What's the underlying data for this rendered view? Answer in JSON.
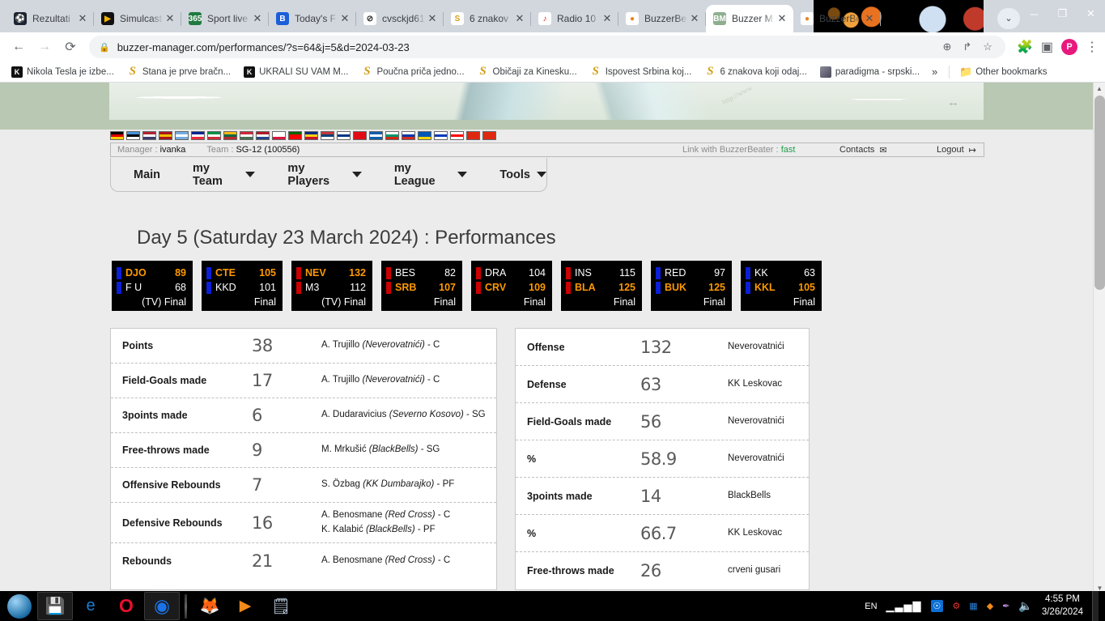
{
  "browser": {
    "tabs": [
      {
        "label": "Rezultati",
        "favicon": "soccer-ball-icon",
        "fav_bg": "#1b2430",
        "fav_fg": "#ffffff",
        "fav_text": "⚽",
        "active": false
      },
      {
        "label": "Simulcast",
        "favicon": "play-circle-icon",
        "fav_bg": "#111111",
        "fav_fg": "#f5b301",
        "fav_text": "▶",
        "active": false
      },
      {
        "label": "Sport live",
        "favicon": "365-icon",
        "fav_bg": "#1f7a3f",
        "fav_fg": "#ffffff",
        "fav_text": "365",
        "active": false
      },
      {
        "label": "Today's F",
        "favicon": "b-logo-icon",
        "fav_bg": "#1a5ed8",
        "fav_fg": "#ffffff",
        "fav_text": "B",
        "active": false
      },
      {
        "label": "cvsckjd61",
        "favicon": "circle-slash-icon",
        "fav_bg": "#ffffff",
        "fav_fg": "#333333",
        "fav_text": "⊘",
        "active": false
      },
      {
        "label": "6 znakov",
        "favicon": "espreso-icon",
        "fav_bg": "#ffffff",
        "fav_fg": "#d4a017",
        "fav_text": "S",
        "active": false
      },
      {
        "label": "Radio 10",
        "favicon": "radio-icon",
        "fav_bg": "#ffffff",
        "fav_fg": "#d22",
        "fav_text": "♪",
        "active": false
      },
      {
        "label": "BuzzerBe",
        "favicon": "basketball-icon",
        "fav_bg": "#ffffff",
        "fav_fg": "#e8861a",
        "fav_text": "●",
        "active": false
      },
      {
        "label": "Buzzer M",
        "favicon": "buzzer-manager-icon",
        "fav_bg": "#8fae8f",
        "fav_fg": "#ffffff",
        "fav_text": "BM",
        "active": true
      },
      {
        "label": "BuzzerBe",
        "favicon": "basketball-icon",
        "fav_bg": "#ffffff",
        "fav_fg": "#e8861a",
        "fav_text": "●",
        "active": false
      }
    ],
    "new_tab_label": "+",
    "tab_search_label": "⌄",
    "window_controls": {
      "minimize": "─",
      "maximize": "❐",
      "close": "✕"
    },
    "nav": {
      "back": "←",
      "forward": "→",
      "reload": "⟳"
    },
    "omnibox": {
      "lock_icon": "🔒",
      "url": "buzzer-manager.com/performances/?s=64&j=5&d=2024-03-23",
      "zoom_icon": "⊕",
      "share_icon": "↱",
      "bookmark_icon": "☆"
    },
    "toolbar": {
      "extensions_icon": "🧩",
      "sidepanel_icon": "▣",
      "avatar_initial": "P",
      "menu_icon": "⋮"
    },
    "bookmarks": [
      {
        "label": "Nikola Tesla je izbe...",
        "icon": "kurir"
      },
      {
        "label": "Stana je prve bračn...",
        "icon": "espreso"
      },
      {
        "label": "UKRALI SU VAM M...",
        "icon": "kurir"
      },
      {
        "label": "Poučna priča jedno...",
        "icon": "espreso"
      },
      {
        "label": "Običaji za Kinesku...",
        "icon": "espreso"
      },
      {
        "label": "Ispovest Srbina koj...",
        "icon": "espreso"
      },
      {
        "label": "6 znakova koji odaj...",
        "icon": "espreso"
      },
      {
        "label": "paradigma - srpski...",
        "icon": "img"
      }
    ],
    "bookmarks_overflow": "»",
    "other_bookmarks": "Other bookmarks"
  },
  "site": {
    "flags": [
      {
        "name": "germany",
        "colors": [
          "#000000",
          "#dd0000",
          "#ffce00"
        ]
      },
      {
        "name": "estonia",
        "colors": [
          "#4891d9",
          "#000000",
          "#ffffff"
        ]
      },
      {
        "name": "usa",
        "colors": [
          "#b22234",
          "#ffffff",
          "#3c3b6e"
        ]
      },
      {
        "name": "spain",
        "colors": [
          "#aa151b",
          "#f1bf00",
          "#aa151b"
        ]
      },
      {
        "name": "argentina",
        "colors": [
          "#74acdf",
          "#ffffff",
          "#74acdf"
        ]
      },
      {
        "name": "france",
        "colors": [
          "#002395",
          "#ffffff",
          "#ed2939"
        ]
      },
      {
        "name": "italy",
        "colors": [
          "#009246",
          "#ffffff",
          "#ce2b37"
        ]
      },
      {
        "name": "lithuania",
        "colors": [
          "#fdb913",
          "#006a44",
          "#c1272d"
        ]
      },
      {
        "name": "hungary",
        "colors": [
          "#ce2939",
          "#ffffff",
          "#477050"
        ]
      },
      {
        "name": "netherlands",
        "colors": [
          "#ae1c28",
          "#ffffff",
          "#21468b"
        ]
      },
      {
        "name": "poland",
        "colors": [
          "#ffffff",
          "#ffffff",
          "#dc143c"
        ]
      },
      {
        "name": "portugal",
        "colors": [
          "#006600",
          "#ff0000",
          "#ff0000"
        ]
      },
      {
        "name": "romania",
        "colors": [
          "#002b7f",
          "#fcd116",
          "#ce1126"
        ]
      },
      {
        "name": "serbia",
        "colors": [
          "#c6363c",
          "#0c4076",
          "#ffffff"
        ]
      },
      {
        "name": "finland",
        "colors": [
          "#ffffff",
          "#003580",
          "#ffffff"
        ]
      },
      {
        "name": "turkey",
        "colors": [
          "#e30a17",
          "#e30a17",
          "#e30a17"
        ]
      },
      {
        "name": "greece",
        "colors": [
          "#0d5eaf",
          "#ffffff",
          "#0d5eaf"
        ]
      },
      {
        "name": "bulgaria",
        "colors": [
          "#ffffff",
          "#00966e",
          "#d62612"
        ]
      },
      {
        "name": "russia",
        "colors": [
          "#ffffff",
          "#0039a6",
          "#d52b1e"
        ]
      },
      {
        "name": "ukraine",
        "colors": [
          "#0057b7",
          "#0057b7",
          "#ffd700"
        ]
      },
      {
        "name": "israel",
        "colors": [
          "#ffffff",
          "#0038b8",
          "#ffffff"
        ]
      },
      {
        "name": "georgia",
        "colors": [
          "#ffffff",
          "#ff0000",
          "#ffffff"
        ]
      },
      {
        "name": "china",
        "colors": [
          "#de2910",
          "#de2910",
          "#de2910"
        ]
      },
      {
        "name": "china-2",
        "colors": [
          "#de2910",
          "#de2910",
          "#de2910"
        ]
      }
    ],
    "infobar": {
      "manager_label": "Manager :",
      "manager_value": "ivanka",
      "team_label": "Team :",
      "team_value": "SG-12 (100556)",
      "link_label": "Link with BuzzerBeater :",
      "link_value": "fast",
      "contacts_label": "Contacts",
      "contacts_icon": "✉",
      "logout_label": "Logout",
      "logout_icon": "↦"
    },
    "nav_items": [
      {
        "label": "Main",
        "has_caret": false
      },
      {
        "label": "my Team",
        "has_caret": true
      },
      {
        "label": "my Players",
        "has_caret": true
      },
      {
        "label": "my League",
        "has_caret": true
      },
      {
        "label": "Tools",
        "has_caret": true
      }
    ],
    "page_title": "Day 5 (Saturday 23 March 2024) : Performances",
    "scoreboxes": [
      {
        "bar": "blue",
        "home": "DJO",
        "home_score": "89",
        "away": "F U",
        "away_score": "68",
        "winner": "home",
        "status": "(TV) Final"
      },
      {
        "bar": "blue",
        "home": "CTE",
        "home_score": "105",
        "away": "KKD",
        "away_score": "101",
        "winner": "home",
        "status": "Final"
      },
      {
        "bar": "red",
        "home": "NEV",
        "home_score": "132",
        "away": "M3",
        "away_score": "112",
        "winner": "home",
        "status": "(TV) Final"
      },
      {
        "bar": "red",
        "home": "BES",
        "home_score": "82",
        "away": "SRB",
        "away_score": "107",
        "winner": "away",
        "status": "Final"
      },
      {
        "bar": "red",
        "home": "DRA",
        "home_score": "104",
        "away": "CRV",
        "away_score": "109",
        "winner": "away",
        "status": "Final"
      },
      {
        "bar": "red",
        "home": "INS",
        "home_score": "115",
        "away": "BLA",
        "away_score": "125",
        "winner": "away",
        "status": "Final"
      },
      {
        "bar": "blue",
        "home": "RED",
        "home_score": "97",
        "away": "BUK",
        "away_score": "125",
        "winner": "away",
        "status": "Final"
      },
      {
        "bar": "blue",
        "home": "KK",
        "home_score": "63",
        "away": "KKL",
        "away_score": "105",
        "winner": "away",
        "status": "Final"
      }
    ],
    "player_leaders": [
      {
        "stat": "Points",
        "value": "38",
        "entries": [
          {
            "player": "A. Trujillo",
            "team": "Neverovatnići",
            "pos": "C"
          }
        ]
      },
      {
        "stat": "Field-Goals made",
        "value": "17",
        "entries": [
          {
            "player": "A. Trujillo",
            "team": "Neverovatnići",
            "pos": "C"
          }
        ]
      },
      {
        "stat": "3points made",
        "value": "6",
        "entries": [
          {
            "player": "A. Dudaravicius",
            "team": "Severno Kosovo",
            "pos": "SG"
          }
        ]
      },
      {
        "stat": "Free-throws made",
        "value": "9",
        "entries": [
          {
            "player": "M. Mrkušić",
            "team": "BlackBells",
            "pos": "SG"
          }
        ]
      },
      {
        "stat": "Offensive Rebounds",
        "value": "7",
        "entries": [
          {
            "player": "S. Özbag",
            "team": "KK Dumbarajko",
            "pos": "PF"
          }
        ]
      },
      {
        "stat": "Defensive Rebounds",
        "value": "16",
        "entries": [
          {
            "player": "A. Benosmane",
            "team": "Red Cross",
            "pos": "C"
          },
          {
            "player": "K. Kalabić",
            "team": "BlackBells",
            "pos": "PF"
          }
        ]
      },
      {
        "stat": "Rebounds",
        "value": "21",
        "entries": [
          {
            "player": "A. Benosmane",
            "team": "Red Cross",
            "pos": "C"
          }
        ]
      }
    ],
    "team_leaders": [
      {
        "stat": "Offense",
        "value": "132",
        "team": "Neverovatnići"
      },
      {
        "stat": "Defense",
        "value": "63",
        "team": "KK Leskovac"
      },
      {
        "stat": "Field-Goals made",
        "value": "56",
        "team": "Neverovatnići"
      },
      {
        "stat": "%",
        "value": "58.9",
        "team": "Neverovatnići"
      },
      {
        "stat": "3points made",
        "value": "14",
        "team": "BlackBells"
      },
      {
        "stat": "%",
        "value": "66.7",
        "team": "KK Leskovac"
      },
      {
        "stat": "Free-throws made",
        "value": "26",
        "team": "crveni gusari"
      }
    ],
    "scrollbar": {
      "up": "▲",
      "down": "▼"
    }
  },
  "taskbar": {
    "start_label": "⊞",
    "items": [
      {
        "name": "save-app",
        "glyph": "💾",
        "open": true
      },
      {
        "name": "internet-explorer",
        "glyph": "e",
        "open": false
      },
      {
        "name": "opera",
        "glyph": "O",
        "open": false
      },
      {
        "name": "chrome",
        "glyph": "◉",
        "open": true
      },
      {
        "name": "firefox",
        "glyph": "🦊",
        "open": false
      },
      {
        "name": "media-player",
        "glyph": "▶",
        "open": false
      },
      {
        "name": "notepad",
        "glyph": "🗒",
        "open": false
      }
    ],
    "tray": {
      "language": "EN",
      "signal_icon": "ᶥ",
      "onedrive_icon": "☁",
      "network_icon": "✕",
      "windows_icon": "⊞",
      "antivirus_icon": "◆",
      "pen_icon": "✒",
      "volume_icon": "🔊",
      "time": "4:55 PM",
      "date": "3/26/2024"
    }
  }
}
